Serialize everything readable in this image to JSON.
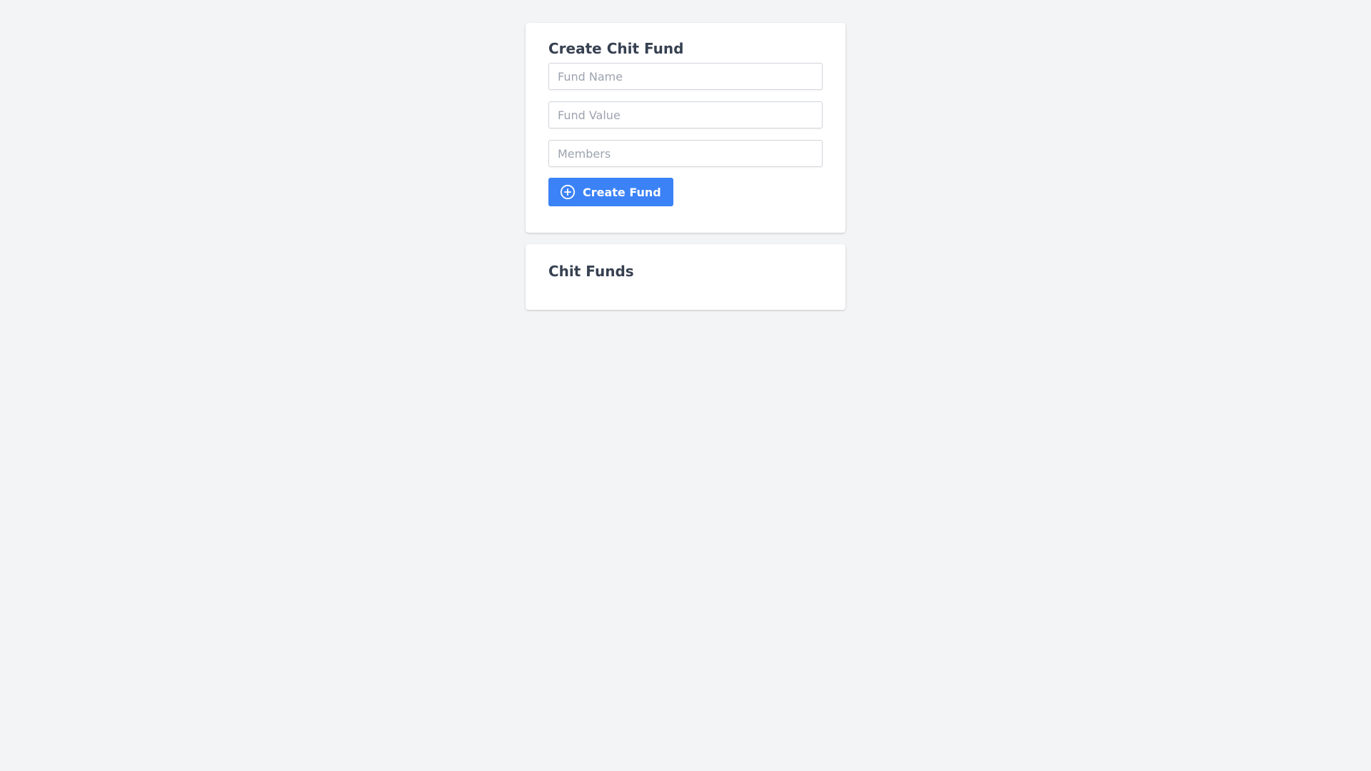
{
  "create_form": {
    "title": "Create Chit Fund",
    "fund_name_placeholder": "Fund Name",
    "fund_value_placeholder": "Fund Value",
    "members_placeholder": "Members",
    "submit_label": "Create Fund",
    "submit_icon": "plus-circle-icon"
  },
  "fund_list": {
    "title": "Chit Funds",
    "items": []
  },
  "colors": {
    "background": "#f3f4f6",
    "card": "#ffffff",
    "accent": "#3b82f6",
    "heading": "#374151",
    "placeholder": "#9ca3af"
  }
}
